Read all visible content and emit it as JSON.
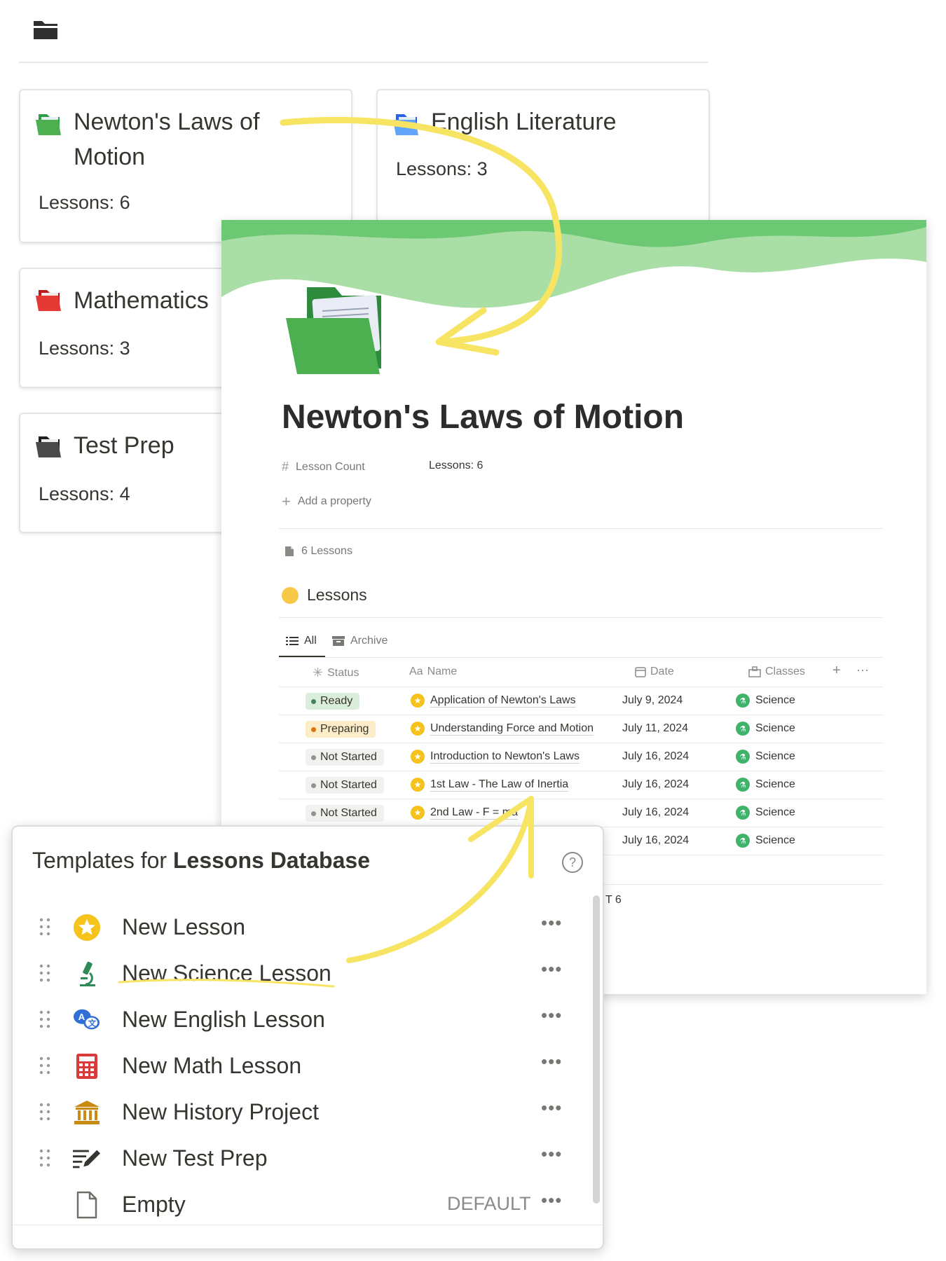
{
  "cards": [
    {
      "title_line1": "Newton's Laws of",
      "title_line2": "Motion",
      "count": "Lessons: 6",
      "folder_color": "#4caf50"
    },
    {
      "title_line1": "English Literature",
      "count": "Lessons: 3",
      "folder_color": "#3b82f6"
    },
    {
      "title_line1": "Mathematics",
      "count": "Lessons: 3",
      "folder_color": "#e53935"
    },
    {
      "title_line1": "Test Prep",
      "count": "Lessons: 4",
      "folder_color": "#37352f"
    }
  ],
  "page": {
    "title": "Newton's Laws of Motion",
    "property_icon": "#",
    "property_name": "Lesson Count",
    "property_value": "Lessons: 6",
    "add_property": "Add a property",
    "backlinks": "6 Lessons",
    "database_title": "Lessons",
    "views": {
      "all": "All",
      "archive": "Archive"
    },
    "columns": {
      "status": "Status",
      "name_prefix": "Aa",
      "name": "Name",
      "date": "Date",
      "classes": "Classes",
      "add": "+",
      "more": "···"
    },
    "rows": [
      {
        "status": "Ready",
        "status_bg": "#dbeddb",
        "status_dot": "#448361",
        "name": "Application of Newton's Laws",
        "date": "July 9, 2024",
        "class": "Science"
      },
      {
        "status": "Preparing",
        "status_bg": "#fdecc8",
        "status_dot": "#d9730d",
        "name": "Understanding Force and Motion",
        "date": "July 11, 2024",
        "class": "Science"
      },
      {
        "status": "Not Started",
        "status_bg": "#f1f1ef",
        "status_dot": "#91918e",
        "name": "Introduction to Newton's Laws",
        "date": "July 16, 2024",
        "class": "Science"
      },
      {
        "status": "Not Started",
        "status_bg": "#f1f1ef",
        "status_dot": "#91918e",
        "name": "1st Law - The Law of Inertia",
        "date": "July 16, 2024",
        "class": "Science"
      },
      {
        "status": "Not Started",
        "status_bg": "#f1f1ef",
        "status_dot": "#91918e",
        "name": "2nd Law - F = ma",
        "date": "July 16, 2024",
        "class": "Science"
      },
      {
        "status": "",
        "status_bg": "",
        "status_dot": "",
        "name": "",
        "date": "July 16, 2024",
        "class": "Science"
      }
    ],
    "count_tail": "T 6"
  },
  "templates": {
    "title_prefix": "Templates for ",
    "title_db": "Lessons Database",
    "help": "?",
    "items": [
      {
        "label": "New Lesson",
        "icon": "star-icon"
      },
      {
        "label": "New Science Lesson",
        "icon": "microscope-icon"
      },
      {
        "label": "New English Lesson",
        "icon": "translate-icon"
      },
      {
        "label": "New Math Lesson",
        "icon": "calculator-icon"
      },
      {
        "label": "New History Project",
        "icon": "museum-icon"
      },
      {
        "label": "New Test Prep",
        "icon": "checklist-pen-icon"
      },
      {
        "label": "Empty",
        "icon": "page-icon",
        "badge": "DEFAULT"
      }
    ],
    "more": "•••"
  },
  "colors": {
    "accent_green": "#4caf50",
    "arrow_yellow": "#f7e463"
  }
}
